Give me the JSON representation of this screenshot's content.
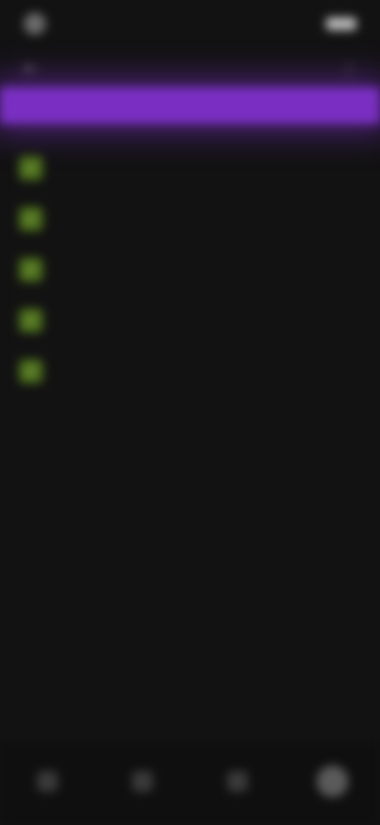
{
  "status_bar": {
    "left_text": "",
    "right_text": ""
  },
  "app_bar": {
    "title": ""
  },
  "banner": {
    "text": ""
  },
  "list": {
    "items": [
      {
        "label": ""
      },
      {
        "label": ""
      },
      {
        "label": ""
      },
      {
        "label": ""
      },
      {
        "label": ""
      }
    ]
  },
  "bottom_nav": {
    "items": [
      {
        "label": "",
        "icon": "nav-icon-1"
      },
      {
        "label": "",
        "icon": "nav-icon-2"
      },
      {
        "label": "",
        "icon": "nav-icon-3"
      },
      {
        "label": "",
        "icon": "nav-icon-4"
      }
    ],
    "active_index": 3
  },
  "colors": {
    "banner": "#7a2fc2",
    "check": "#4c6f1c",
    "background": "#121212"
  }
}
